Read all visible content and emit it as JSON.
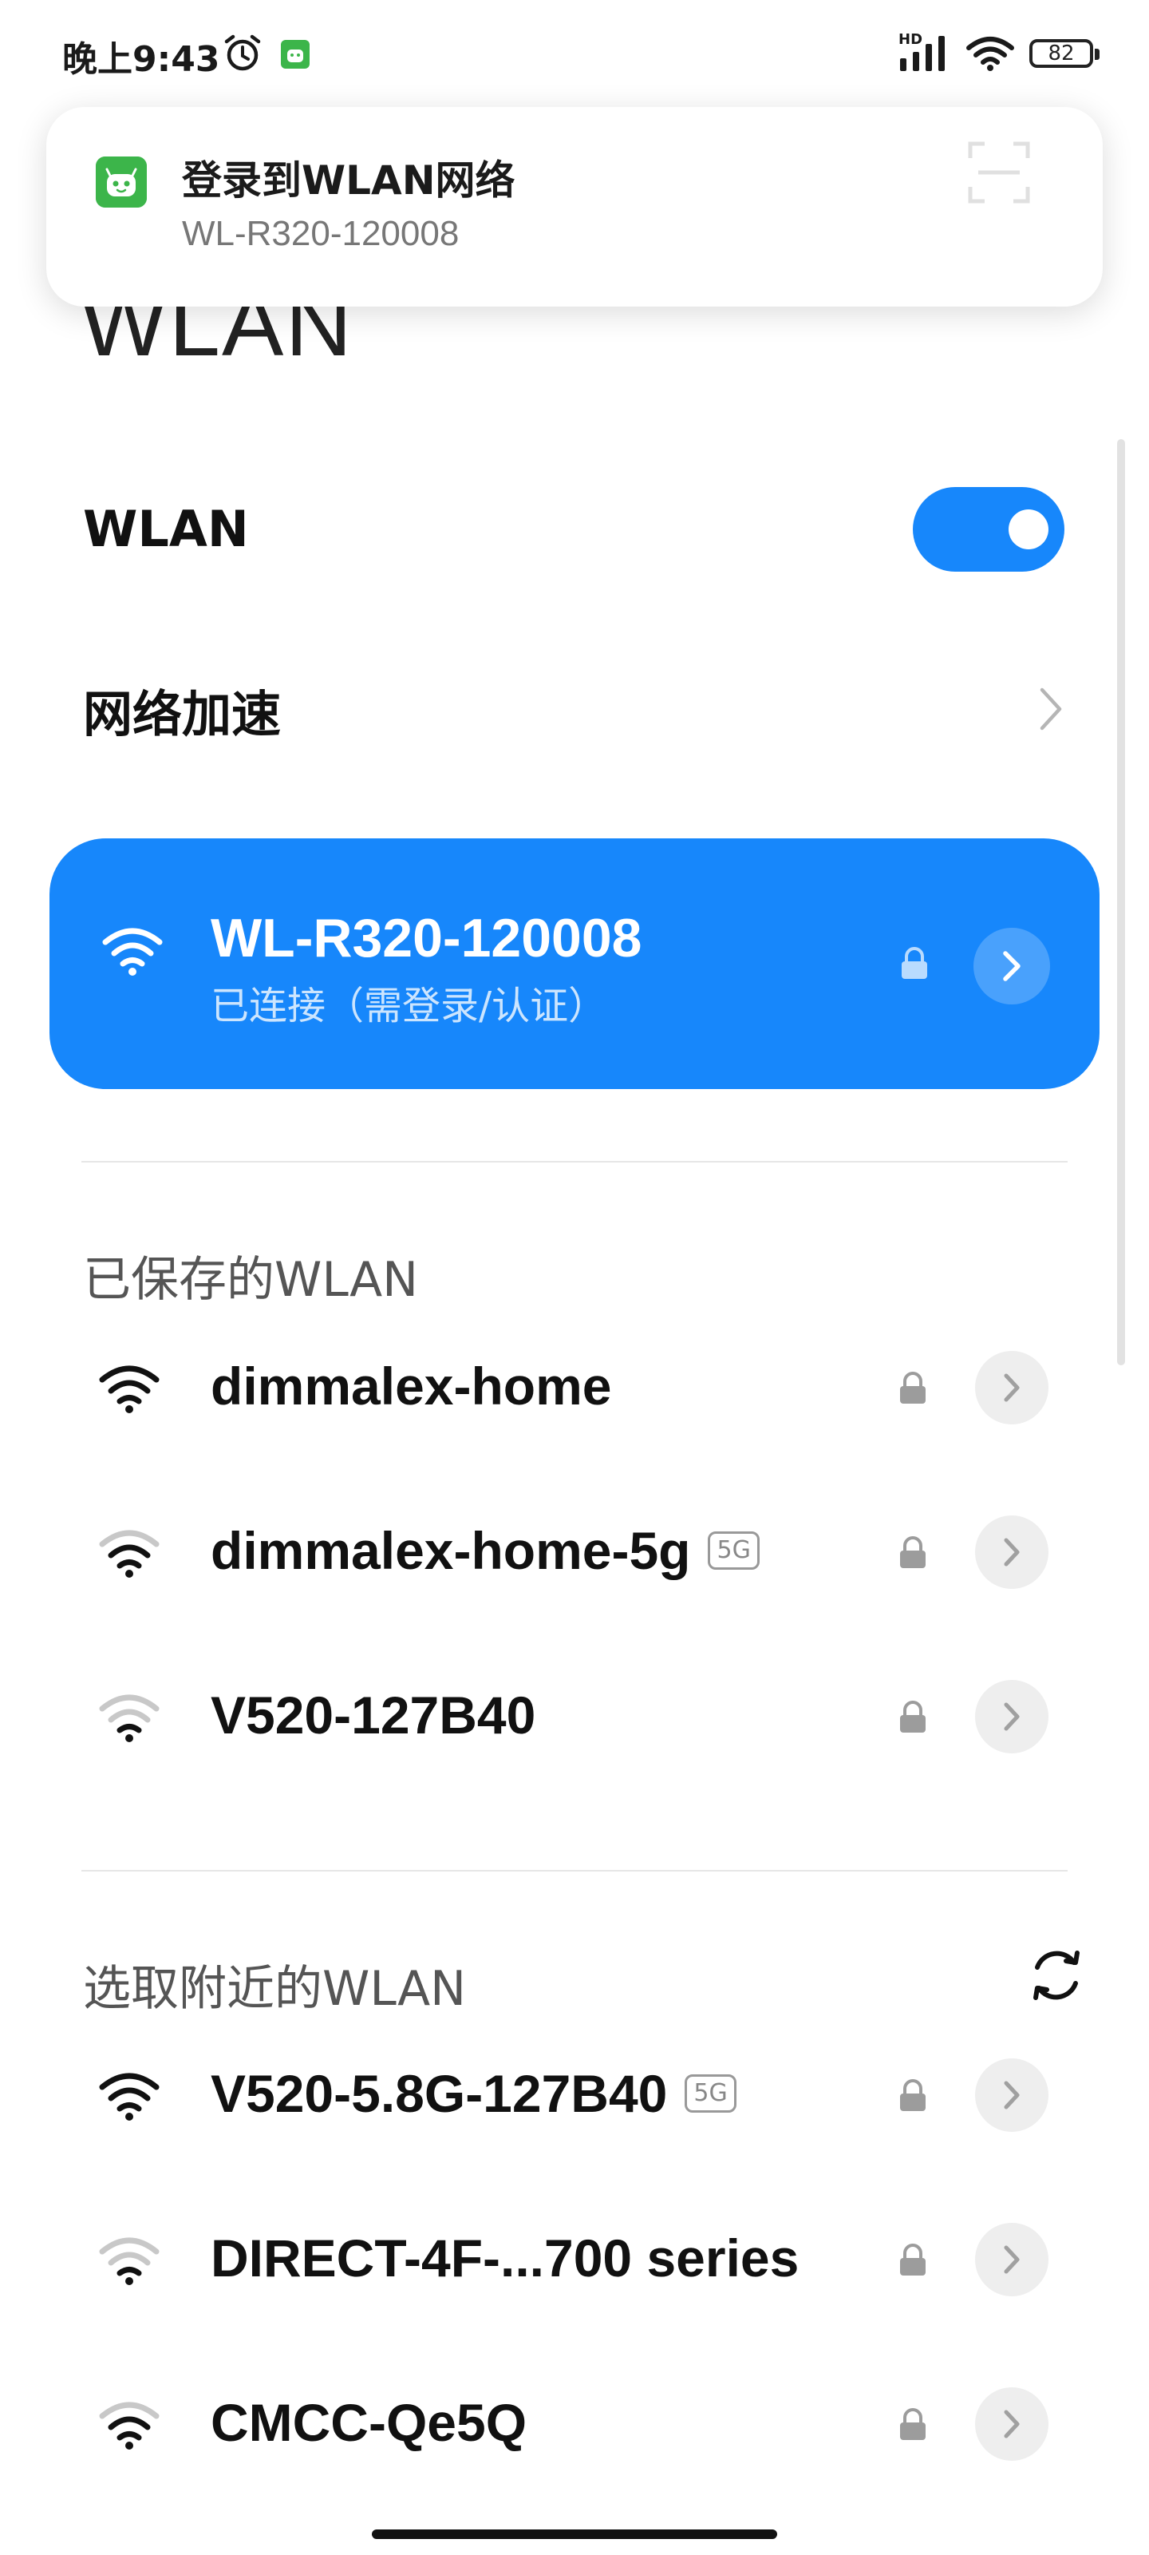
{
  "status_bar": {
    "time": "晚上9:43",
    "icons": [
      "alarm-icon",
      "app-notification-icon",
      "hd-signal-icon",
      "wifi-icon",
      "battery-icon"
    ],
    "hd_label": "HD",
    "battery": "82"
  },
  "notification": {
    "title": "登录到WLAN网络",
    "subtitle": "WL-R320-120008",
    "app_icon": "android-app-icon",
    "icon_color": "#3cb54a"
  },
  "page": {
    "title": "WLAN"
  },
  "settings": {
    "wlan_label": "WLAN",
    "wlan_enabled": true,
    "network_accel_label": "网络加速"
  },
  "connected": {
    "name": "WL-R320-120008",
    "status": "已连接（需登录/认证）",
    "color": "#1787fb"
  },
  "saved_section": {
    "title": "已保存的WLAN",
    "networks": [
      {
        "name": "dimmalex-home",
        "badge": ""
      },
      {
        "name": "dimmalex-home-5g",
        "badge": "5G"
      },
      {
        "name": "V520-127B40",
        "badge": ""
      }
    ]
  },
  "nearby_section": {
    "title": "选取附近的WLAN",
    "networks": [
      {
        "name": "V520-5.8G-127B40",
        "badge": "5G"
      },
      {
        "name": "DIRECT-4F-...700 series",
        "badge": ""
      },
      {
        "name": "CMCC-Qe5Q",
        "badge": ""
      }
    ]
  },
  "accent_color": "#1787fb"
}
